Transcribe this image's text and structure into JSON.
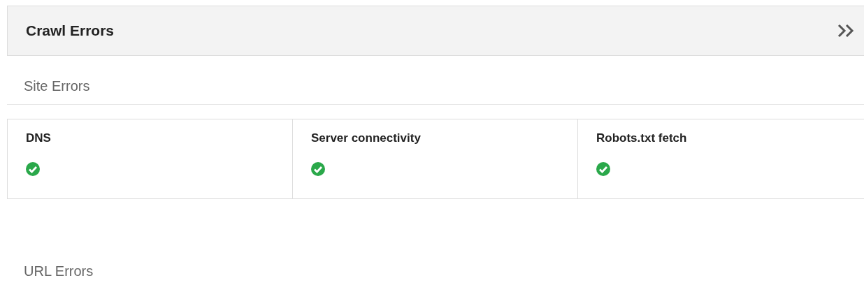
{
  "panel": {
    "title": "Crawl Errors"
  },
  "site_errors": {
    "heading": "Site Errors",
    "checks": [
      {
        "label": "DNS",
        "passed": true
      },
      {
        "label": "Server connectivity",
        "passed": true
      },
      {
        "label": "Robots.txt fetch",
        "passed": true
      }
    ]
  },
  "url_errors": {
    "heading": "URL Errors"
  }
}
